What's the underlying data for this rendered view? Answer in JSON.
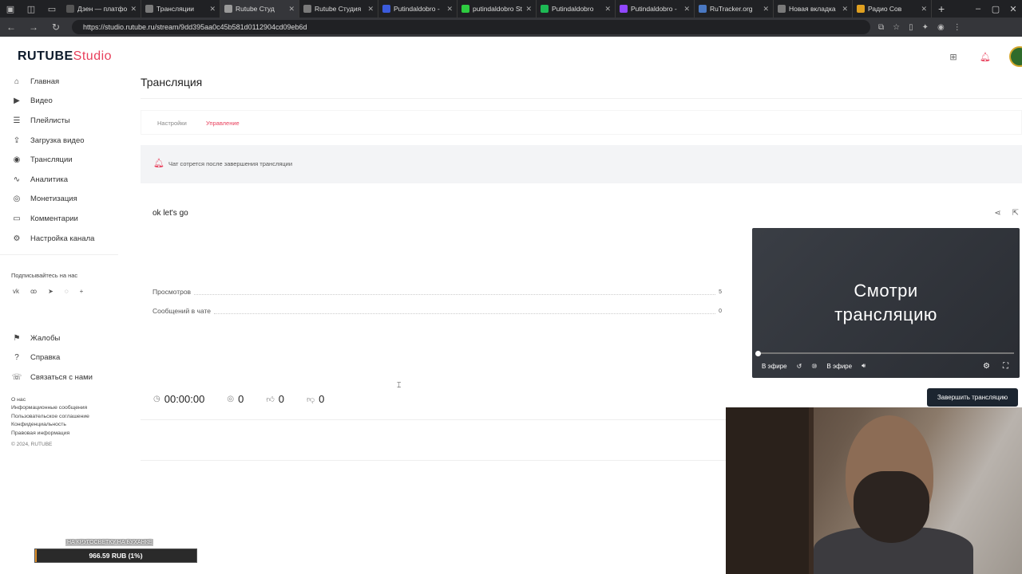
{
  "browser": {
    "tabs": [
      {
        "title": "Дзен — платфо",
        "color": "#555555",
        "active": false
      },
      {
        "title": "Трансляции",
        "color": "#7a7a7a",
        "active": false
      },
      {
        "title": "Rutube Студ",
        "color": "#9a9a9a",
        "active": true
      },
      {
        "title": "Rutube Студия",
        "color": "#7a7a7a",
        "active": false
      },
      {
        "title": "Putindaldobro -",
        "color": "#3b5bdb",
        "active": false
      },
      {
        "title": "putindaldobro St",
        "color": "#2ecc40",
        "active": false
      },
      {
        "title": "Putindaldobro",
        "color": "#1db954",
        "active": false
      },
      {
        "title": "Putindaldobro -",
        "color": "#9147ff",
        "active": false
      },
      {
        "title": "RuTracker.org",
        "color": "#4a78c2",
        "active": false
      },
      {
        "title": "Новая вкладка",
        "color": "#7a7a7a",
        "active": false
      },
      {
        "title": "Радио Сов",
        "color": "#e0a020",
        "active": false
      }
    ],
    "url": "https://studio.rutube.ru/stream/9dd395aa0c45b581d0112904cd09eb6d"
  },
  "app": {
    "logo_main": "RUTUBE",
    "logo_studio": "Studio",
    "accent": "#e83f5b"
  },
  "sidebar": {
    "items": [
      {
        "label": "Главная",
        "icon": "home-icon"
      },
      {
        "label": "Видео",
        "icon": "video-icon"
      },
      {
        "label": "Плейлисты",
        "icon": "playlist-icon"
      },
      {
        "label": "Загрузка видео",
        "icon": "upload-icon"
      },
      {
        "label": "Трансляции",
        "icon": "broadcast-icon"
      },
      {
        "label": "Аналитика",
        "icon": "analytics-icon"
      },
      {
        "label": "Монетизация",
        "icon": "monetization-icon"
      },
      {
        "label": "Комментарии",
        "icon": "comments-icon"
      },
      {
        "label": "Настройка канала",
        "icon": "channel-settings-icon"
      }
    ],
    "follow_label": "Подписывайтесь на нас",
    "secondary": [
      {
        "label": "Жалобы",
        "icon": "complaints-icon"
      },
      {
        "label": "Справка",
        "icon": "help-icon"
      },
      {
        "label": "Связаться с нами",
        "icon": "contact-icon"
      }
    ],
    "footer_links": [
      "О нас",
      "Информационные сообщения",
      "Пользовательское соглашение",
      "Конфиденциальность",
      "Правовая информация"
    ],
    "copyright": "© 2024, RUTUBE"
  },
  "page": {
    "title": "Трансляция",
    "tabs": [
      "Настройки",
      "Управление"
    ],
    "active_tab": "Управление",
    "notice": "Чат сотрется после завершения трансляции",
    "stream_title": "ok let's go",
    "stats": [
      {
        "label": "Просмотров",
        "value": "5"
      },
      {
        "label": "Сообщений в чате",
        "value": "0"
      }
    ],
    "metrics": {
      "duration": "00:00:00",
      "viewers": "0",
      "likes": "0",
      "dislikes": "0"
    },
    "player": {
      "line1": "Смотри",
      "line2": "трансляцию",
      "live_badge": "В эфире",
      "live_label": "В эфире"
    },
    "end_button": "Завершить трансляцию"
  },
  "overlay": {
    "tag": "НА КРУГОСВЕТКУ НА БУХАНКЕ",
    "donation": "966.59 RUB (1%)",
    "donation_progress": 0.01
  }
}
